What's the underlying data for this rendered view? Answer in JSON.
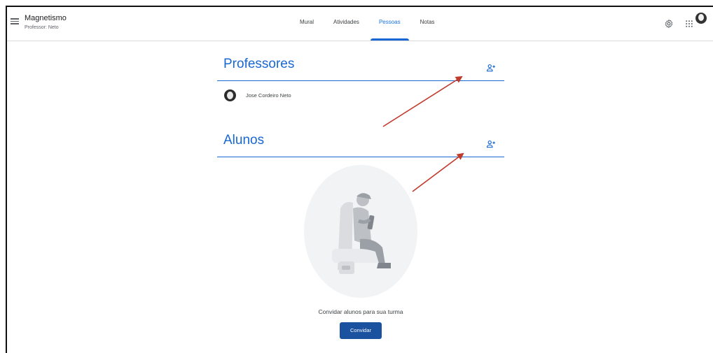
{
  "header": {
    "class_name": "Magnetismo",
    "teacher_line": "Professor: Neto"
  },
  "tabs": [
    {
      "label": "Mural",
      "active": false
    },
    {
      "label": "Atividades",
      "active": false
    },
    {
      "label": "Pessoas",
      "active": true
    },
    {
      "label": "Notas",
      "active": false
    }
  ],
  "icons": {
    "menu": "menu-icon",
    "settings": "gear-icon",
    "apps": "apps-grid-icon",
    "account": "avatar",
    "add_teacher": "add-person-icon",
    "add_student": "add-person-icon"
  },
  "teachers": {
    "title": "Professores",
    "list": [
      "Jose Cordeiro Neto"
    ]
  },
  "students": {
    "title": "Alunos",
    "empty_message": "Convidar alunos para sua turma",
    "invite_label": "Convidar"
  },
  "colors": {
    "accent": "#1967d2",
    "button": "#1a52a0",
    "annotation_arrow": "#c0392b"
  }
}
